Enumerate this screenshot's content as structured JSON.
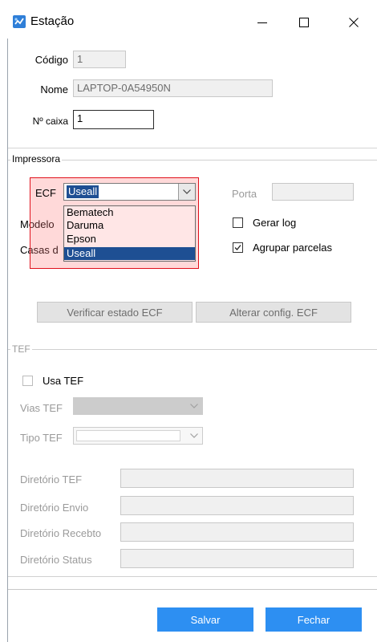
{
  "window": {
    "title": "Estação"
  },
  "identificacao": {
    "codigo_label": "Código",
    "codigo_value": "1",
    "nome_label": "Nome",
    "nome_value": "LAPTOP-0A54950N",
    "caixa_label": "Nº caixa",
    "caixa_value": "1"
  },
  "impressora": {
    "group_label": "Impressora",
    "ecf_label": "ECF",
    "ecf_selected": "Useall",
    "ecf_options": [
      "Bematech",
      "Daruma",
      "Epson",
      "Useall"
    ],
    "modelo_label": "Modelo",
    "casas_label": "Casas d",
    "porta_label": "Porta",
    "porta_value": "",
    "gerar_log_label": "Gerar log",
    "gerar_log_checked": false,
    "agrupar_label": "Agrupar parcelas",
    "agrupar_checked": true,
    "verificar_button": "Verificar estado  ECF",
    "alterar_button": "Alterar config.  ECF"
  },
  "tef": {
    "group_label": "TEF",
    "usa_tef_label": "Usa TEF",
    "vias_label": "Vias TEF",
    "tipo_label": "Tipo TEF",
    "dir_tef_label": "Diretório TEF",
    "dir_envio_label": "Diretório Envio",
    "dir_recebto_label": "Diretório Recebto",
    "dir_status_label": "Diretório Status"
  },
  "footer": {
    "salvar": "Salvar",
    "fechar": "Fechar"
  },
  "colors": {
    "accent": "#2d8ff2",
    "selection": "#1e4f93",
    "highlight_border": "#e0111c"
  }
}
